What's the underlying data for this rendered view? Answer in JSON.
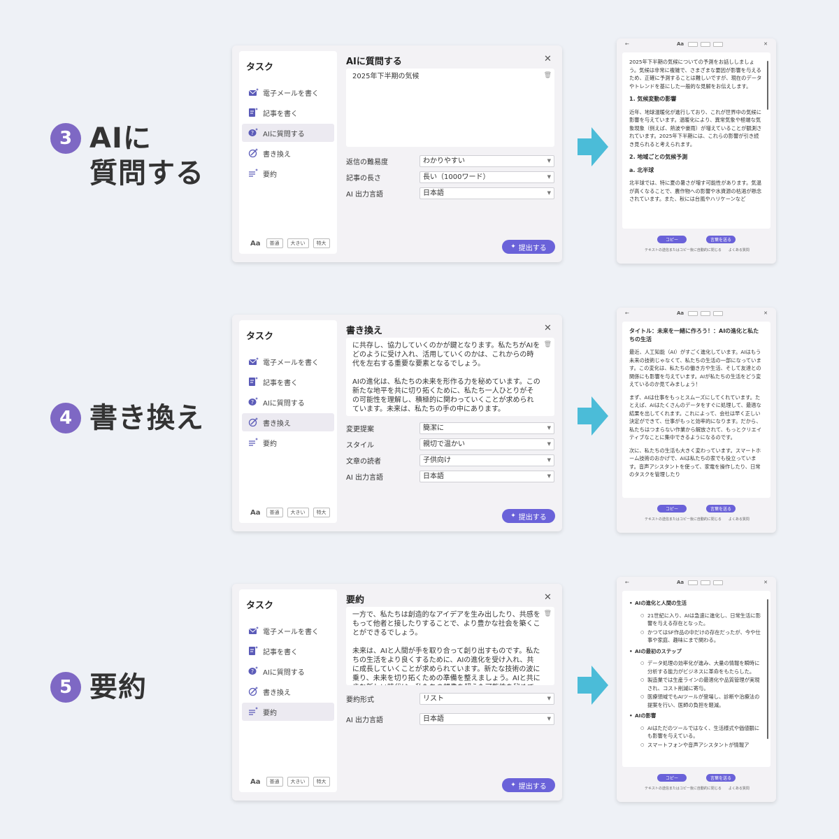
{
  "colors": {
    "accent": "#7e68c4",
    "button": "#6a62d9",
    "arrow": "#4bbcd8",
    "background": "#eef1f6"
  },
  "sidebar": {
    "title": "タスク",
    "items": [
      {
        "label": "電子メールを書く",
        "icon": "mail-sparkle-icon"
      },
      {
        "label": "記事を書く",
        "icon": "document-edit-icon"
      },
      {
        "label": "AIに質問する",
        "icon": "chat-question-icon"
      },
      {
        "label": "書き換え",
        "icon": "rewrite-icon"
      },
      {
        "label": "要約",
        "icon": "summary-icon"
      }
    ],
    "font_label": "Aa",
    "sizes": [
      "普通",
      "大きい",
      "特大"
    ]
  },
  "submit_label": "提出する",
  "result_buttons": {
    "copy": "コピー",
    "insert": "言葉を送る"
  },
  "result_note": "テキストの送信またはコピー後に自動的に閉じる　　よくある質問",
  "steps": [
    {
      "number": "3",
      "title_line1": "AIに",
      "title_line2": "質問する",
      "panel_title": "AIに質問する",
      "input_text": "2025年下半期の気候",
      "fields": [
        {
          "label": "返信の難易度",
          "value": "わかりやすい"
        },
        {
          "label": "記事の長さ",
          "value": "長い（1000ワード）"
        },
        {
          "label": "AI 出力言語",
          "value": "日本語"
        }
      ],
      "result": {
        "p1": "2025年下半期の気候についての予測をお話ししましょう。気候は非常に複雑で、さまざまな要因が影響を与えるため、正確に予測することは難しいですが、現在のデータやトレンドを基にした一般的な見解をお伝えします。",
        "h1": "1. 気候変動の影響",
        "p2": "近年、地球温暖化が進行しており、これが世界中の気候に影響を与えています。温暖化により、異常気象や極端な気象現象（例えば、熱波や豪雨）が増えていることが観測されています。2025年下半期には、これらの影響が引き続き見られると考えられます。",
        "h2": "2. 地域ごとの気候予測",
        "h3": "a. 北半球",
        "p3": "北半球では、特に夏の暑さが増す可能性があります。気温が高くなることで、農作物への影響や水資源の枯渇が懸念されています。また、秋には台風やハリケーンなど"
      }
    },
    {
      "number": "4",
      "title_line1": "書き換え",
      "panel_title": "書き換え",
      "input_p1": "に共存し、協力していくのかが鍵となります。私たちがAIをどのように受け入れ、活用していくのかは、これからの時代を左右する重要な要素となるでしょう。",
      "input_p2": "AIの進化は、私たちの未来を形作る力を秘めています。この新たな地平を共に切り拓くために、私たち一人ひとりがその可能性を理解し、積極的に関わっていくことが求められています。未来は、私たちの手の中にあります。",
      "fields": [
        {
          "label": "変更提案",
          "value": "簡潔に"
        },
        {
          "label": "スタイル",
          "value": "親切で温かい"
        },
        {
          "label": "文章の読者",
          "value": "子供向け"
        },
        {
          "label": "AI 出力言語",
          "value": "日本語"
        }
      ],
      "result": {
        "h1": "タイトル：未来を一緒に作ろう！：AIの進化と私たちの生活",
        "p1": "最近、人工知能（AI）がすごく進化しています。AIはもう未来の技術じゃなくて、私たちの生活の一部になっています。この変化は、私たちの働き方や生活、そして友達との関係にも影響を与えています。AIが私たちの生活をどう変えているのか見てみましょう！",
        "p2": "まず、AIは仕事をもっとスムーズにしてくれています。たとえば、AIはたくさんのデータをすぐに処理して、最適な結果を出してくれます。これによって、会社は早く正しい決定ができて、仕事がもっと効率的になります。だから、私たちはつまらない作業から解放されて、もっとクリエイティブなことに集中できるようになるのです。",
        "p3": "次に、私たちの生活も大きく変わっています。スマートホーム技術のおかげで、AIは私たちの家でも役立っています。音声アシスタントを使って、家電を操作したり、日常のタスクを管理したり"
      }
    },
    {
      "number": "5",
      "title_line1": "要約",
      "panel_title": "要約",
      "input_p1": "一方で、私たちは創造的なアイデアを生み出したり、共感をもって他者と接したりすることで、より豊かな社会を築くことができるでしょう。",
      "input_p2": "未来は、AIと人間が手を取り合って創り出すものです。私たちの生活をより良くするために、AIの進化を受け入れ、共に成長していくことが求められています。新たな技術の波に乗り、未来を切り拓くための準備を整えましょう。AIと共に歩む新しい時代は、私たちの想像を超えた可能性を秘めています。",
      "fields": [
        {
          "label": "要約形式",
          "value": "リスト"
        },
        {
          "label": "AI 出力言語",
          "value": "日本語"
        }
      ],
      "result": {
        "t1": "AIの進化と人間の生活",
        "t1_s1": "21世紀に入り、AIは急速に進化し、日常生活に影響を与える存在となった。",
        "t1_s2": "かつてはSF作品の中だけの存在だったが、今や仕事や家庭、趣味にまで関わる。",
        "t2": "AIの最初のステップ",
        "t2_s1": "データ処理の効率化が進み、大量の情報を瞬時に分析する能力がビジネスに革命をもたらした。",
        "t2_s2": "製造業では生産ラインの最適化や品質管理が実現され、コスト削減に寄与。",
        "t2_s3": "医療領域でもAIツールが登場し、診断や治療法の提案を行い、医師の負担を軽減。",
        "t3": "AIの影響",
        "t3_s1": "AIはただのツールではなく、生活様式や価値観にも影響を与えている。",
        "t3_s2": "スマートフォンや音声アシスタントが情報ア"
      }
    }
  ]
}
